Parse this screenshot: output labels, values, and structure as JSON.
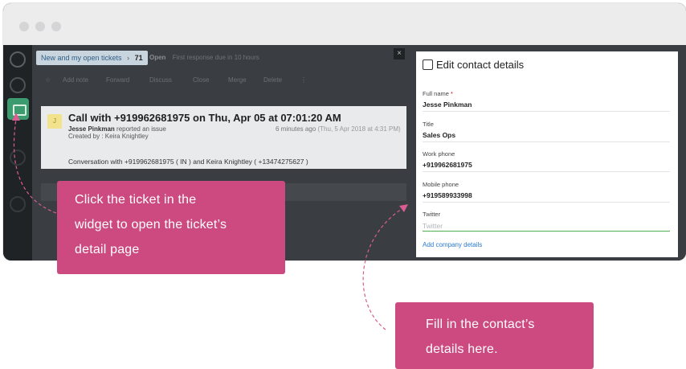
{
  "browser": {
    "window_dots": 3
  },
  "topbar": {
    "breadcrumb_text": "New and my open tickets",
    "breadcrumb_sep": "›",
    "ticket_count": "71",
    "status": "Open",
    "status_note": "First response due in 10 hours"
  },
  "toolbar": {
    "items": [
      "Add note",
      "Forward",
      "Discuss",
      "Close",
      "Merge",
      "Delete"
    ],
    "more": "⋮"
  },
  "ticket": {
    "avatar_letter": "J",
    "title": "Call with +919962681975 on Thu, Apr 05 at 07:01:20 AM",
    "requester": "Jesse Pinkman",
    "reported": "reported an issue",
    "created_by": "Created by : Keira Knightley",
    "time_ago": "6 minutes ago",
    "timestamp": "(Thu, 5 Apr 2018 at 4:31 PM)",
    "conversation": "Conversation with +919962681975 ( IN ) and Keira Knightley ( +13474275627 )"
  },
  "panel": {
    "close_symbol": "×",
    "title": "Edit contact details",
    "fields": [
      {
        "label": "Full name",
        "required": "*",
        "value": "Jesse Pinkman"
      },
      {
        "label": "Title",
        "value": "Sales Ops"
      },
      {
        "label": "Work phone",
        "value": "+919962681975"
      },
      {
        "label": "Mobile phone",
        "value": "+919589933998"
      },
      {
        "label": "Twitter",
        "placeholder": "Twitter"
      }
    ],
    "add_company": "Add company details"
  },
  "callouts": {
    "first": [
      "Click the ticket in the",
      "widget to open the ticket’s",
      "detail page"
    ],
    "second": [
      "Fill in the contact’s",
      "details here."
    ]
  },
  "colors": {
    "callout": "#cc4a80",
    "sidebar_active": "#3d9c6f",
    "link": "#2a7ad2",
    "input_focus": "#4caf50"
  }
}
